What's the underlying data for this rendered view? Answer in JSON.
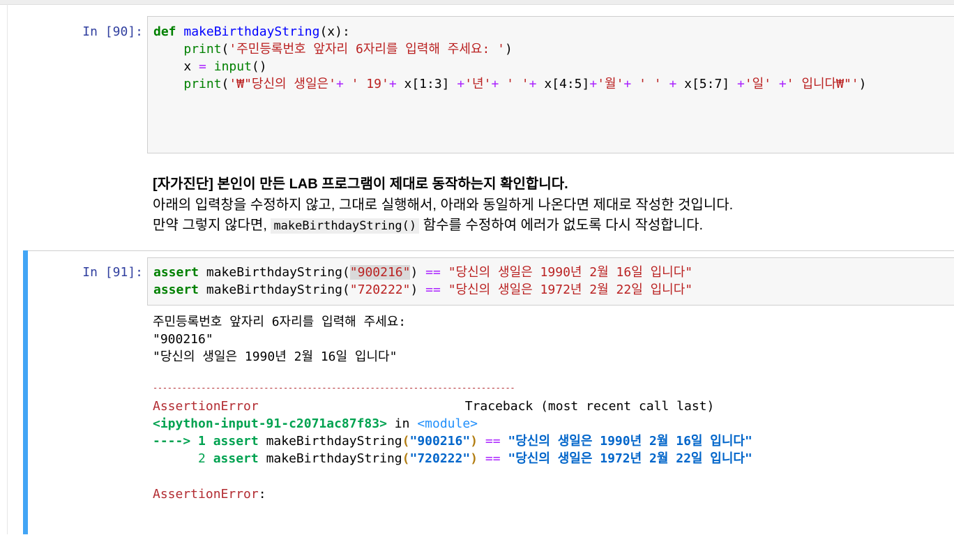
{
  "cell90": {
    "prompt": "In [90]:",
    "line1": {
      "kw": "def",
      "fn": "makeBirthdayString",
      "rest": "(x):"
    },
    "line2": {
      "indent": "    ",
      "fn": "print",
      "open": "(",
      "str": "'주민등록번호 앞자리 6자리를 입력해 주세요: '",
      "close": ")"
    },
    "line3": {
      "indent": "    ",
      "var": "x ",
      "op": "=",
      "sp": " ",
      "fn": "input",
      "rest": "()"
    },
    "line4": {
      "indent": "    ",
      "fn": "print",
      "open": "(",
      "s1": "'₩\"당신의 생일은'",
      "p1": "+",
      "s2": " ' 19'",
      "p2": "+",
      "a1": " x[1:3] ",
      "p3": "+",
      "s3": "'년'",
      "p4": "+",
      "s4": " ' '",
      "p5": "+",
      "a2": " x[4:5]",
      "p6": "+",
      "s5": "'월'",
      "p7": "+",
      "s6": " ' ' ",
      "p8": "+",
      "a3": " x[5:7] ",
      "p9": "+",
      "s7": "'일' ",
      "p10": "+",
      "s8": "' 입니다₩\"'",
      "close": ")"
    }
  },
  "markdown": {
    "line1_bold": "[자가진단] 본인이 만든 LAB 프로그램이 제대로 동작하는지 확인합니다.",
    "line2": "아래의 입력창을 수정하지 않고, 그대로 실행해서, 아래와 동일하게 나온다면 제대로 작성한 것입니다.",
    "line3_pre": "만약 그렇지 않다면, ",
    "line3_code": "makeBirthdayString()",
    "line3_post": " 함수를 수정하여 에러가 없도록 다시 작성합니다."
  },
  "cell91": {
    "prompt": "In [91]:",
    "line1": {
      "kw": "assert",
      "fn": " makeBirthdayString(",
      "arg": "\"900216\"",
      "close": ")",
      "op": " == ",
      "str": "\"당신의 생일은 1990년 2월 16일 입니다\""
    },
    "line2": {
      "kw": "assert",
      "fn": " makeBirthdayString(",
      "arg": "\"720222\"",
      "close": ")",
      "op": " == ",
      "str": "\"당신의 생일은 1972년 2월 22일 입니다\""
    }
  },
  "output": {
    "stdout1": "주민등록번호 앞자리 6자리를 입력해 주세요:",
    "stdout2": "\"900216\"",
    "stdout3": "\"당신의 생일은 1990년 2월 16일 입니다\"",
    "separator": "---------------------------------------------------------------------------",
    "err_name": "AssertionError",
    "traceback_label": "Traceback (most recent call last)",
    "input_ref": "<ipython-input-91-c2071ac87f83>",
    "in_word": " in ",
    "module": "<module>",
    "tb1_arrow": "----> 1 ",
    "tb1_kw": "assert",
    "tb1_fn": " makeBirthdayString",
    "tb1_open": "(",
    "tb1_arg": "\"900216\"",
    "tb1_close": ")",
    "tb1_op": " == ",
    "tb1_str": "\"당신의 생일은 1990년 2월 16일 입니다\"",
    "tb2_lineno": "      2 ",
    "tb2_kw": "assert",
    "tb2_fn": " makeBirthdayString",
    "tb2_open": "(",
    "tb2_arg": "\"720222\"",
    "tb2_close": ")",
    "tb2_op": " == ",
    "tb2_str": "\"당신의 생일은 1972년 2월 22일 입니다\"",
    "err_final": "AssertionError",
    "err_colon": ":"
  }
}
